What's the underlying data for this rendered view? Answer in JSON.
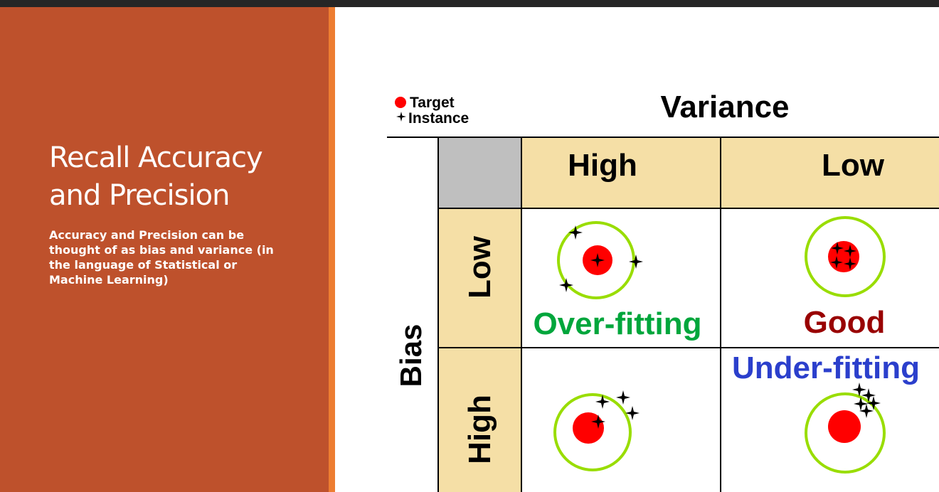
{
  "slide": {
    "title": "Recall Accuracy and Precision",
    "body": "Accuracy and Precision can be thought of as bias and variance (in the language of Statistical or Machine Learning)"
  },
  "figure": {
    "legend": {
      "target_label": "Target",
      "instance_label": "Instance"
    },
    "column_header": "Variance",
    "row_header": "Bias",
    "columns": [
      "High",
      "Low"
    ],
    "rows": [
      "Low",
      "High"
    ],
    "cells": {
      "low_bias_high_variance": "Over-fitting",
      "low_bias_low_variance": "Good",
      "high_bias_low_variance": "Under-fitting"
    },
    "colors": {
      "target": "#ff0000",
      "ring": "#99dd00",
      "header_fill": "#f5dfa6",
      "corner_fill": "#bfbfbf",
      "overfitting": "#00a63c",
      "good": "#990000",
      "underfitting": "#2b3fcc",
      "slide_bg": "#be512c",
      "accent": "#ed7d31"
    }
  }
}
